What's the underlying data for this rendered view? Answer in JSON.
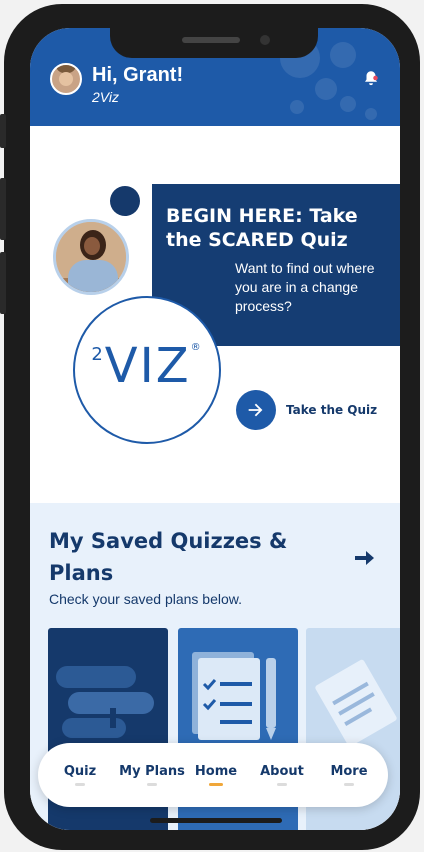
{
  "header": {
    "greeting": "Hi, Grant!",
    "subtitle": "2Viz",
    "background_color": "#1e5aa8",
    "bell_icon": "bell-icon"
  },
  "quiz_promo": {
    "title": "BEGIN HERE: Take the SCARED Quiz",
    "description": "Want to find out where you are in a change process?",
    "logo_text": "VIZ",
    "logo_prefix": "2",
    "cta_label": "Take the Quiz",
    "card_color": "#153d73"
  },
  "saved": {
    "title": "My Saved Quizzes & Plans",
    "subtitle": "Check your saved plans below.",
    "background_color": "#e8f1fb"
  },
  "tabs": [
    {
      "label": "Quiz",
      "active": false
    },
    {
      "label": "My Plans",
      "active": false
    },
    {
      "label": "Home",
      "active": true
    },
    {
      "label": "About",
      "active": false
    },
    {
      "label": "More",
      "active": false
    }
  ],
  "colors": {
    "accent": "#1e5aa8",
    "dark": "#15396b",
    "active_indicator": "#f0a73a"
  }
}
